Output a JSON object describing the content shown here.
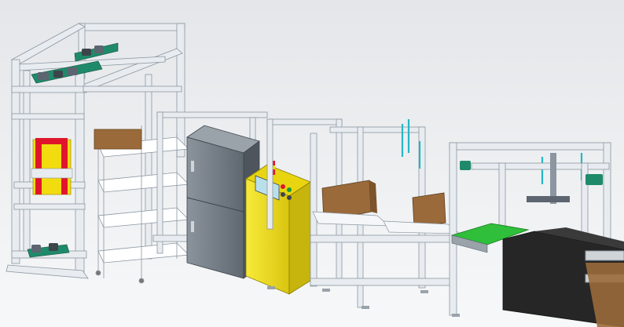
{
  "view": {
    "background_top": "#e4e6e9",
    "background_bottom": "#f7f8f9"
  },
  "palette": {
    "frame": "#e8ecf0",
    "frame_edge": "#8b96a1",
    "frame_shadow": "#b9c2cb",
    "cabinet": "#6f7780",
    "cabinet_light": "#8b949c",
    "control_panel": "#f4e21a",
    "control_panel_dark": "#cdb90d",
    "screen": "#b9e0ea",
    "red_bracket": "#e0152b",
    "yellow_plate": "#f2dc10",
    "box_brown": "#9a6a3a",
    "box_brown_light": "#b98754",
    "green_belt": "#2fbf3a",
    "green_mount": "#1b7f5f",
    "teal_rod": "#25b7c3",
    "black_body": "#262626",
    "black_side": "#3a3a3a"
  }
}
